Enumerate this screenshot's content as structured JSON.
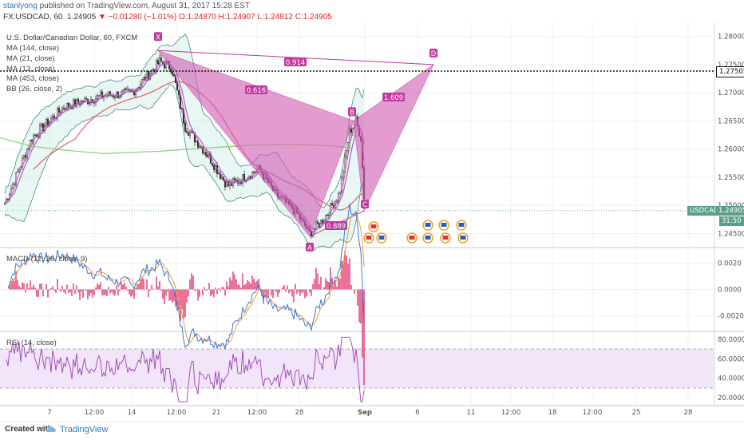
{
  "header": {
    "user": "stanlyong",
    "published": " published on TradingView.com, August 31, 2017 15:28 EST",
    "symbol": "FX:USDCAD, 60",
    "last": "1.24905",
    "change": "▼ −0.01280 (−1.01%)",
    "ohlc": "O:1.24870 H:1.24907 L:1.24812 C:1.24905"
  },
  "legends": {
    "title": "U.S. Dollar/Canadian Dollar, 60, FXCM",
    "ma144": "MA (144, close)",
    "ma21": "MA (21, close)",
    "ma13": "MA (13, close)",
    "ma453": "MA (453, close)",
    "bb": "BB (26, close, 2)",
    "macd": "MACD (12, 26, close, 9)",
    "rsi": "RSI (14, close)"
  },
  "price_badges": {
    "dotted_level": "1.27505",
    "usdcad_label": "USDCAD",
    "current": "1.24905",
    "countdown": "31:50"
  },
  "footer": {
    "created_with": "Created with",
    "brand": "TradingView"
  },
  "colors": {
    "pattern_fill": "#d260b4",
    "pattern_line": "#c2399d",
    "candle": "#2e2e2e",
    "bb_line": "#4a8a80",
    "bb_fill": "#bfe8e0",
    "ma144": "#e06a6a",
    "ma21": "#a060c8",
    "ma13": "#d44fb0",
    "ma453": "#8ed670",
    "macd_line": "#3b78d8",
    "signal_line": "#f29b34",
    "hist": "#e0356d",
    "rsi_line": "#9c3fb8",
    "rsi_band": "#efdff7"
  },
  "chart_data": [
    {
      "type": "line",
      "panel": "price",
      "title": "U.S. Dollar/Canadian Dollar, 60, FXCM",
      "y_ticks": [
        "1.28000",
        "1.27500",
        "1.27000",
        "1.26500",
        "1.26000",
        "1.25500",
        "1.25000",
        "1.24500"
      ],
      "ylim": [
        1.2425,
        1.2825
      ],
      "x_ticks": [
        "7",
        "12:00",
        "14",
        "12:00",
        "21",
        "12:00",
        "28",
        "Sep",
        "6",
        "11",
        "12:00",
        "18",
        "12:00",
        "25",
        "28"
      ],
      "harmonic_pattern": {
        "points": [
          {
            "label": "X",
            "price": 1.2775
          },
          {
            "label": "A",
            "price": 1.2445
          },
          {
            "label": "B",
            "price": 1.265
          },
          {
            "label": "C",
            "price": 1.249
          },
          {
            "label": "D",
            "price": 1.275
          }
        ],
        "ratios": [
          {
            "label": "0.914"
          },
          {
            "label": "0.616"
          },
          {
            "label": "1.609"
          },
          {
            "label": "0.889"
          }
        ]
      },
      "dotted_level": 1.27505,
      "last_price": 1.24905
    },
    {
      "type": "line",
      "panel": "macd",
      "title": "MACD (12, 26, close, 9)",
      "y_ticks": [
        "0.0020",
        "0.0000",
        "-0.0020"
      ],
      "ylim": [
        -0.0032,
        0.0032
      ]
    },
    {
      "type": "line",
      "panel": "rsi",
      "title": "RSI (14, close)",
      "y_ticks": [
        "80.0000",
        "60.0000",
        "40.0000",
        "20.0000"
      ],
      "ylim": [
        12,
        88
      ],
      "band": [
        30,
        70
      ]
    }
  ]
}
